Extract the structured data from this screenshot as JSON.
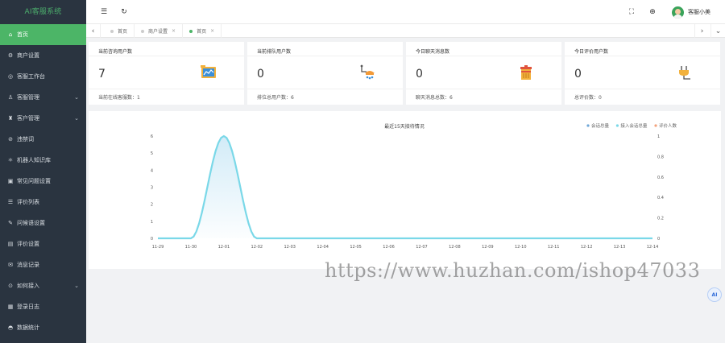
{
  "app": {
    "logo": "AI客服系统"
  },
  "sidebar": {
    "items": [
      {
        "label": "首页",
        "icon": "home-icon",
        "glyph": "⌂",
        "active": true,
        "chevron": false
      },
      {
        "label": "商户设置",
        "icon": "settings-icon",
        "glyph": "⚙",
        "active": false,
        "chevron": false
      },
      {
        "label": "客服工作台",
        "icon": "workbench-icon",
        "glyph": "◎",
        "active": false,
        "chevron": false
      },
      {
        "label": "客服管理",
        "icon": "user-icon",
        "glyph": "♙",
        "active": false,
        "chevron": true
      },
      {
        "label": "客户管理",
        "icon": "customers-icon",
        "glyph": "♜",
        "active": false,
        "chevron": true
      },
      {
        "label": "违禁词",
        "icon": "ban-icon",
        "glyph": "⊘",
        "active": false,
        "chevron": false
      },
      {
        "label": "机器人知识库",
        "icon": "robot-icon",
        "glyph": "⚛",
        "active": false,
        "chevron": false
      },
      {
        "label": "常见问题设置",
        "icon": "question-icon",
        "glyph": "▣",
        "active": false,
        "chevron": false
      },
      {
        "label": "评价列表",
        "icon": "list-icon",
        "glyph": "☰",
        "active": false,
        "chevron": false
      },
      {
        "label": "问候语设置",
        "icon": "greeting-icon",
        "glyph": "✎",
        "active": false,
        "chevron": false
      },
      {
        "label": "评价设置",
        "icon": "rating-settings-icon",
        "glyph": "▤",
        "active": false,
        "chevron": false
      },
      {
        "label": "消息记录",
        "icon": "message-icon",
        "glyph": "✉",
        "active": false,
        "chevron": false
      },
      {
        "label": "如何接入",
        "icon": "connect-icon",
        "glyph": "⊙",
        "active": false,
        "chevron": true
      },
      {
        "label": "登录日志",
        "icon": "log-icon",
        "glyph": "▦",
        "active": false,
        "chevron": false
      },
      {
        "label": "数据统计",
        "icon": "stats-icon",
        "glyph": "◓",
        "active": false,
        "chevron": false
      }
    ]
  },
  "header": {
    "menu_glyph": "☰",
    "refresh_glyph": "↻",
    "fullscreen_glyph": "⛶",
    "language_glyph": "⊕",
    "user_name": "客服小美"
  },
  "tabs": {
    "left_arrow": "‹",
    "right_arrow": "›",
    "more_arrow": "⌄",
    "items": [
      {
        "label": "首页",
        "closable": false,
        "active": false
      },
      {
        "label": "商户设置",
        "closable": true,
        "active": false
      },
      {
        "label": "首页",
        "closable": true,
        "active": true
      }
    ]
  },
  "cards": [
    {
      "title": "当前咨询用户数",
      "value": "7",
      "footer": "当前在线客服数：1",
      "icon": "chart-board-icon"
    },
    {
      "title": "当前排队用户数",
      "value": "0",
      "footer": "排位总用户数：6",
      "icon": "robot-arm-icon"
    },
    {
      "title": "今日聊天消息数",
      "value": "0",
      "footer": "聊天消息总数：6",
      "icon": "trash-bin-icon"
    },
    {
      "title": "今日评价用户数",
      "value": "0",
      "footer": "总评价数：0",
      "icon": "plug-icon"
    }
  ],
  "chart_data": {
    "type": "line",
    "title": "最近15天接待情况",
    "x": [
      "11-29",
      "11-30",
      "12-01",
      "12-02",
      "12-03",
      "12-04",
      "12-05",
      "12-06",
      "12-07",
      "12-08",
      "12-09",
      "12-10",
      "12-11",
      "12-12",
      "12-13",
      "12-14"
    ],
    "series": [
      {
        "name": "会话总量",
        "axis": "left",
        "color": "#6fa7d8",
        "values": [
          0,
          0,
          6,
          0,
          0,
          0,
          0,
          0,
          0,
          0,
          0,
          0,
          0,
          0,
          0,
          0
        ]
      },
      {
        "name": "接入会话总量",
        "axis": "left",
        "color": "#7ad8e8",
        "values": [
          0,
          0,
          6,
          0,
          0,
          0,
          0,
          0,
          0,
          0,
          0,
          0,
          0,
          0,
          0,
          0
        ]
      },
      {
        "name": "评价人数",
        "axis": "right",
        "color": "#f3a27c",
        "values": [
          0,
          0,
          0,
          0,
          0,
          0,
          0,
          0,
          0,
          0,
          0,
          0,
          0,
          0,
          0,
          0
        ]
      }
    ],
    "y_left": {
      "ticks": [
        "0",
        "1",
        "2",
        "3",
        "4",
        "5",
        "6"
      ],
      "range": [
        0,
        6
      ]
    },
    "y_right": {
      "ticks": [
        "0",
        "0.2",
        "0.4",
        "0.6",
        "0.8",
        "1"
      ],
      "range": [
        0,
        1
      ]
    },
    "legend": "top-right",
    "grid": false
  },
  "watermark": "https://www.huzhan.com/ishop47033",
  "ai_button": "AI"
}
